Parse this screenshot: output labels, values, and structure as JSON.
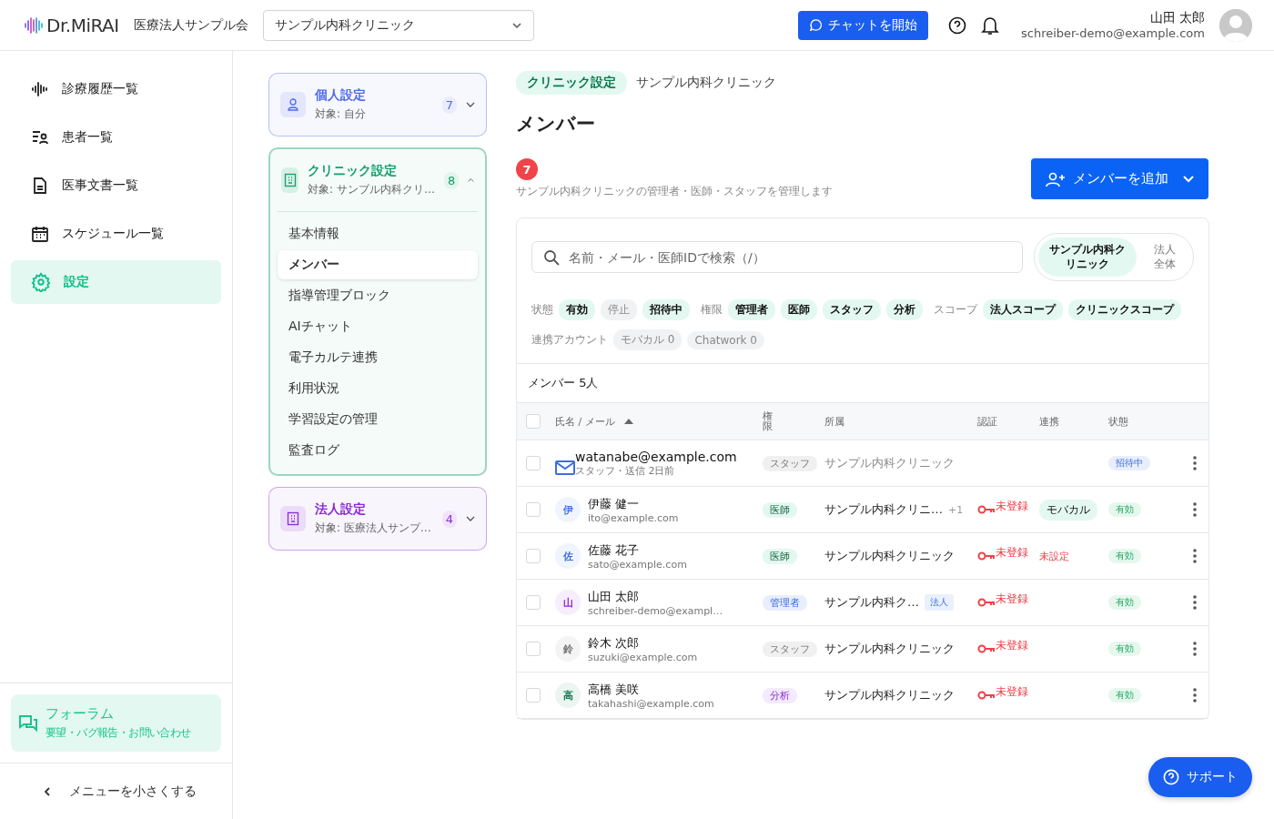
{
  "header": {
    "logo": "Dr.MiRAI",
    "org": "医療法人サンプル会",
    "clinic_select": "サンプル内科クリニック",
    "chat_button": "チャットを開始",
    "user_name": "山田 太郎",
    "user_email": "schreiber-demo@example.com"
  },
  "sidebar": {
    "items": [
      {
        "label": "診療履歴一覧",
        "kind": "history",
        "selected": false
      },
      {
        "label": "患者一覧",
        "kind": "patients",
        "selected": false
      },
      {
        "label": "医事文書一覧",
        "kind": "documents",
        "selected": false
      },
      {
        "label": "スケジュール一覧",
        "kind": "schedule",
        "selected": false
      },
      {
        "label": "設定",
        "kind": "settings",
        "selected": true
      }
    ],
    "forum": {
      "title": "フォーラム",
      "subtitle": "要望・バグ報告・お問い合わせ"
    },
    "collapse": "メニューを小さくする"
  },
  "settings_groups": [
    {
      "title": "個人設定",
      "subtitle": "対象: 自分",
      "count": "7",
      "color": "#4f6bed",
      "kind": "personal",
      "expanded": false
    },
    {
      "title": "クリニック設定",
      "subtitle": "対象: サンプル内科クリ…",
      "count": "8",
      "color": "#14a06e",
      "kind": "clinic",
      "expanded": true,
      "items": [
        {
          "label": "基本情報",
          "selected": false
        },
        {
          "label": "メンバー",
          "selected": true
        },
        {
          "label": "指導管理ブロック",
          "selected": false
        },
        {
          "label": "AIチャット",
          "selected": false
        },
        {
          "label": "電子カルテ連携",
          "selected": false
        },
        {
          "label": "利用状況",
          "selected": false
        },
        {
          "label": "学習設定の管理",
          "selected": false
        },
        {
          "label": "監査ログ",
          "selected": false
        }
      ]
    },
    {
      "title": "法人設定",
      "subtitle": "対象: 医療法人サンプ…",
      "count": "4",
      "color": "#8a2bd6",
      "kind": "corporate",
      "expanded": false
    }
  ],
  "main": {
    "breadcrumb_tag": "クリニック設定",
    "breadcrumb": "サンプル内科クリニック",
    "title": "メンバー",
    "badge": "7",
    "description": "サンプル内科クリニックの管理者・医師・スタッフを管理します",
    "add_button": "メンバーを追加",
    "search": {
      "placeholder": "名前・メール・医師IDで検索（/）"
    },
    "scope_toggle": [
      {
        "label": "サンプル内科クリニック",
        "selected": true
      },
      {
        "label": "法人全体",
        "selected": false
      }
    ],
    "filters": [
      {
        "label": "状態",
        "chips": [
          {
            "label": "有効",
            "on": true
          },
          {
            "label": "停止",
            "on": false
          },
          {
            "label": "招待中",
            "on": true
          }
        ]
      },
      {
        "label": "権限",
        "chips": [
          {
            "label": "管理者",
            "on": true
          },
          {
            "label": "医師",
            "on": true
          },
          {
            "label": "スタッフ",
            "on": true
          },
          {
            "label": "分析",
            "on": true
          }
        ]
      },
      {
        "label": "スコープ",
        "chips": [
          {
            "label": "法人スコープ",
            "on": true
          },
          {
            "label": "クリニックスコープ",
            "on": true
          }
        ]
      },
      {
        "label": "連携アカウント",
        "chips": [
          {
            "label": "モバカル 0",
            "on": false
          },
          {
            "label": "Chatwork 0",
            "on": false
          }
        ]
      }
    ],
    "table": {
      "count": "メンバー 5人",
      "select_all_checked": false,
      "columns": [
        "氏名 / メール",
        "権限",
        "所属",
        "認証",
        "連携",
        "状態"
      ],
      "rows": [
        {
          "kind": "invite",
          "checked": false,
          "name": "watanabe@example.com",
          "sub": "スタッフ・送信 2日前",
          "role": {
            "label": "スタッフ",
            "kind": "staff"
          },
          "affiliation": "サンプル内科クリニック",
          "status": {
            "label": "招待中",
            "kind": "invited"
          }
        },
        {
          "kind": "member",
          "checked": false,
          "avatar": {
            "char": "伊",
            "color": "#3b6fe0"
          },
          "name": "伊藤 健一",
          "sub": "ito@example.com",
          "role": {
            "label": "医師",
            "kind": "doctor"
          },
          "affiliation": "サンプル内科クリニ…",
          "extra": {
            "kind": "count",
            "label": "+1"
          },
          "auth": "未登録",
          "link": {
            "kind": "account",
            "label": "モバカル"
          },
          "status": {
            "label": "有効",
            "kind": "active"
          }
        },
        {
          "kind": "member",
          "checked": false,
          "avatar": {
            "char": "佐",
            "color": "#3b6fe0"
          },
          "name": "佐藤 花子",
          "sub": "sato@example.com",
          "role": {
            "label": "医師",
            "kind": "doctor"
          },
          "affiliation": "サンプル内科クリニック",
          "auth": "未登録",
          "link": {
            "kind": "unset",
            "label": "未設定"
          },
          "status": {
            "label": "有効",
            "kind": "active"
          }
        },
        {
          "kind": "member",
          "checked": false,
          "avatar": {
            "char": "山",
            "color": "#8a2bd6"
          },
          "name": "山田 太郎",
          "sub": "schreiber-demo@exampl…",
          "role": {
            "label": "管理者",
            "kind": "admin"
          },
          "affiliation": "サンプル内科ク…",
          "extra": {
            "kind": "tag",
            "label": "法人"
          },
          "auth": "未登録",
          "status": {
            "label": "有効",
            "kind": "active"
          }
        },
        {
          "kind": "member",
          "checked": false,
          "avatar": {
            "char": "鈴",
            "color": "#777777"
          },
          "name": "鈴木 次郎",
          "sub": "suzuki@example.com",
          "role": {
            "label": "スタッフ",
            "kind": "staff"
          },
          "affiliation": "サンプル内科クリニック",
          "auth": "未登録",
          "status": {
            "label": "有効",
            "kind": "active"
          }
        },
        {
          "kind": "member",
          "checked": false,
          "avatar": {
            "char": "高",
            "color": "#0f7a50"
          },
          "name": "高橋 美咲",
          "sub": "takahashi@example.com",
          "role": {
            "label": "分析",
            "kind": "analyst"
          },
          "affiliation": "サンプル内科クリニック",
          "auth": "未登録",
          "status": {
            "label": "有効",
            "kind": "active"
          }
        }
      ]
    }
  },
  "support_button": "サポート"
}
